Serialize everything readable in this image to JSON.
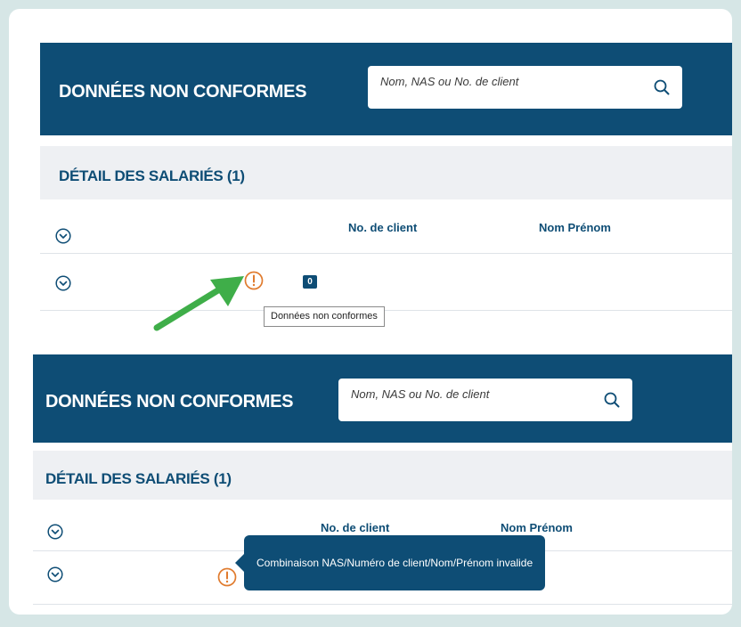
{
  "panels": [
    {
      "topbar_title": "DONNÉES NON CONFORMES",
      "search_placeholder": "Nom, NAS ou No. de client",
      "section_title": "DÉTAIL DES SALARIÉS (1)",
      "columns": [
        "No. de client",
        "Nom Prénom"
      ],
      "row": {
        "count_badge": "0"
      },
      "tooltip": "Données non conformes"
    },
    {
      "topbar_title": "DONNÉES NON CONFORMES",
      "search_placeholder": "Nom, NAS ou No. de client",
      "section_title": "DÉTAIL DES SALARIÉS (1)",
      "columns": [
        "No. de client",
        "Nom Prénom"
      ],
      "tooltip": "Combinaison NAS/Numéro de client/Nom/Prénom invalide"
    }
  ],
  "colors": {
    "brand_blue": "#0e4d75",
    "warning_orange": "#e07b2e",
    "annotation_green": "#3fae49",
    "page_background": "#d6e6e6"
  },
  "icons": [
    "search-icon",
    "chevron-down-icon",
    "warning-icon",
    "annotation-arrow"
  ]
}
